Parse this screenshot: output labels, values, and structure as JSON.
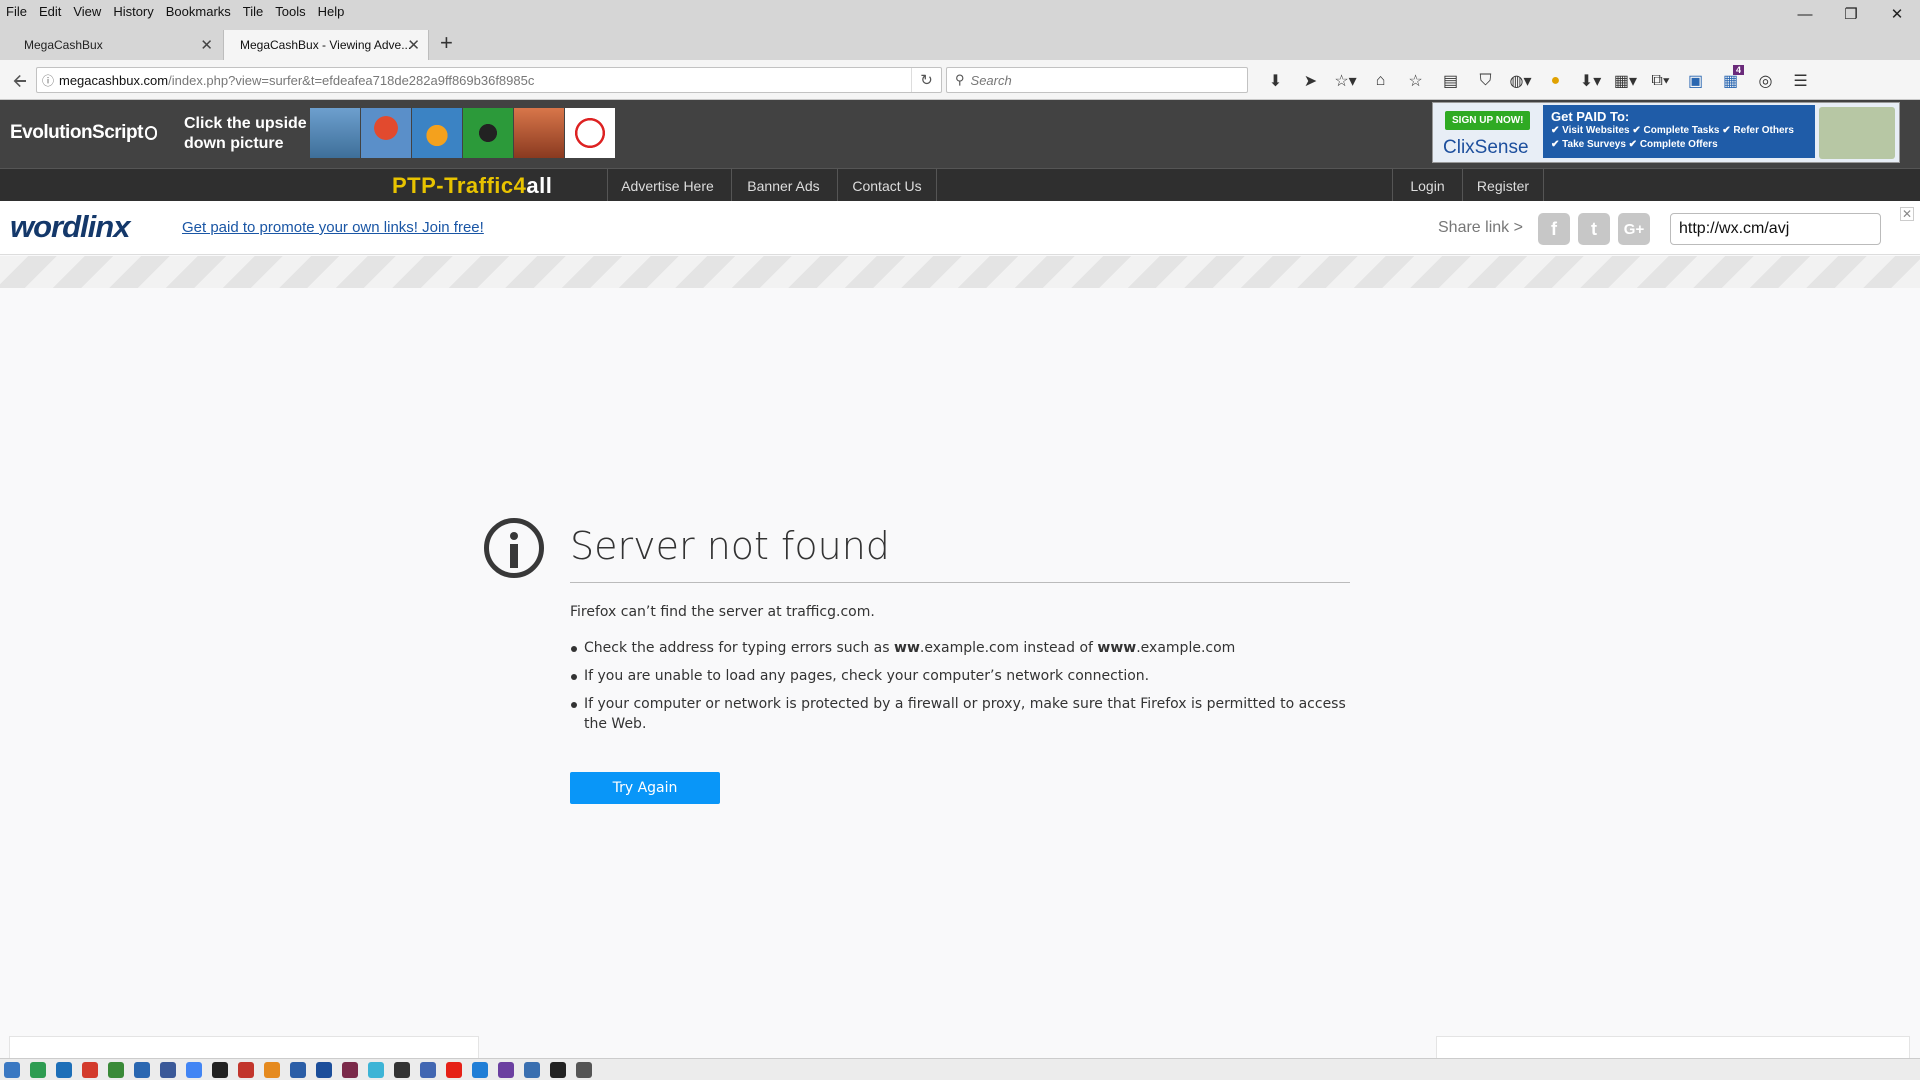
{
  "menu": [
    "File",
    "Edit",
    "View",
    "History",
    "Bookmarks",
    "Tile",
    "Tools",
    "Help"
  ],
  "window_controls": {
    "minimize": "—",
    "restore": "❐",
    "close": "✕"
  },
  "tabs": [
    {
      "title": "MegaCashBux",
      "active": false
    },
    {
      "title": "MegaCashBux - Viewing Adve...",
      "active": true
    }
  ],
  "new_tab_label": "+",
  "url": {
    "host": "megacashbux.com",
    "path": "/index.php?view=surfer&t=efdeafea718de282a9ff869b36f8985c"
  },
  "search": {
    "placeholder": "Search"
  },
  "toolbar_icons": [
    "download-icon",
    "send-icon",
    "star-dropdown-icon",
    "home-icon",
    "bookmark-star-icon",
    "reading-list-icon",
    "pocket-icon",
    "globe-dropdown-icon",
    "color-picker-icon",
    "download-arrow-icon",
    "tile-icon",
    "crop-icon",
    "screenshot-icon",
    "notifications-icon",
    "wrench-icon",
    "menu-icon"
  ],
  "notifications_badge": "4",
  "banner": {
    "evolution_text": "EvolutionScript",
    "click_text_line1": "Click the upside",
    "click_text_line2": "down picture",
    "puzzle_colors": [
      "#6d9fce",
      "#e24a2e",
      "#3b83c4",
      "#2c9a3a",
      "#c96b3b",
      "#ffffff"
    ],
    "clixsense": {
      "signup": "SIGN UP NOW!",
      "brand": "ClixSense",
      "title": "Get PAID To:",
      "opts_line1": "✔ Visit Websites  ✔ Complete Tasks  ✔ Refer Others",
      "opts_line2": "✔ Take Surveys   ✔ Complete Offers"
    }
  },
  "site_nav": {
    "logo_text": "PTP-Traffic",
    "logo_four": "4",
    "logo_all": "all",
    "links": [
      "Advertise Here",
      "Banner Ads",
      "Contact Us"
    ],
    "account_links": [
      "Login",
      "Register"
    ]
  },
  "wordlinx": {
    "logo": "wordlinx",
    "promo": "Get paid to promote your own links! Join free!",
    "share_label": "Share link  >",
    "share_value": "http://wx.cm/avj",
    "close": "✕"
  },
  "error": {
    "title": "Server not found",
    "lead": "Firefox can’t find the server at trafficg.com.",
    "bullet1_pre": "Check the address for typing errors such as ",
    "bullet1_bold1": "ww",
    "bullet1_mid": ".example.com instead of ",
    "bullet1_bold2": "www",
    "bullet1_post": ".example.com",
    "bullet2": "If you are unable to load any pages, check your computer’s network connection.",
    "bullet3": "If your computer or network is protected by a firewall or proxy, make sure that Firefox is permitted to access the Web.",
    "button": "Try Again"
  },
  "addon_colors": [
    "#3a78c2",
    "#2e9c52",
    "#1d6fb8",
    "#d33b2c",
    "#3a8a38",
    "#2a67b1",
    "#3b5998",
    "#4285f4",
    "#222222",
    "#c2362d",
    "#e58a1f",
    "#2b5ea7",
    "#1c4e9a",
    "#7b2a4a",
    "#3db4d6",
    "#333333",
    "#4267b2",
    "#e62117",
    "#1f7ed6",
    "#6b3fa0",
    "#3a6fb0",
    "#222222",
    "#555555"
  ]
}
